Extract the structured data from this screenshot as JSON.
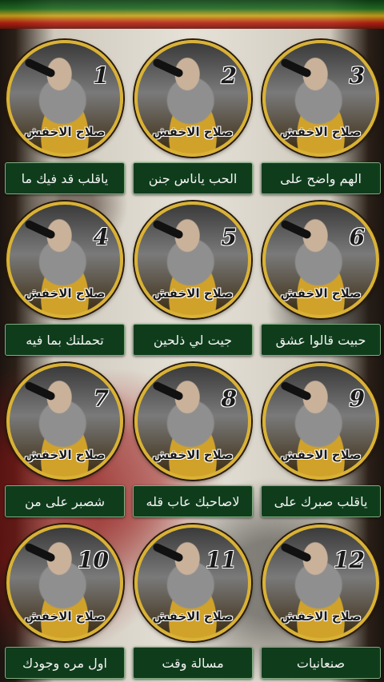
{
  "header": {
    "title": ""
  },
  "artist_label": "صلاح الاخفش",
  "accent_colors": {
    "button_bg": "#0f3d1c",
    "disc_ring": "#d9b236"
  },
  "tracks": [
    {
      "number": "1",
      "label": "ياقلب قد فيك ما"
    },
    {
      "number": "2",
      "label": "الحب ياناس جنن"
    },
    {
      "number": "3",
      "label": "الهم واضح على"
    },
    {
      "number": "4",
      "label": "تحملتك بما فيه"
    },
    {
      "number": "5",
      "label": "جيت لي ذلحين"
    },
    {
      "number": "6",
      "label": "حبيت قالوا عشق"
    },
    {
      "number": "7",
      "label": "شصبر على من"
    },
    {
      "number": "8",
      "label": "لاصاحبك عاب قله"
    },
    {
      "number": "9",
      "label": "ياقلب صبرك على"
    },
    {
      "number": "10",
      "label": "اول مره وجودك"
    },
    {
      "number": "11",
      "label": "مسالة وقت"
    },
    {
      "number": "12",
      "label": "صنعانيات"
    }
  ]
}
